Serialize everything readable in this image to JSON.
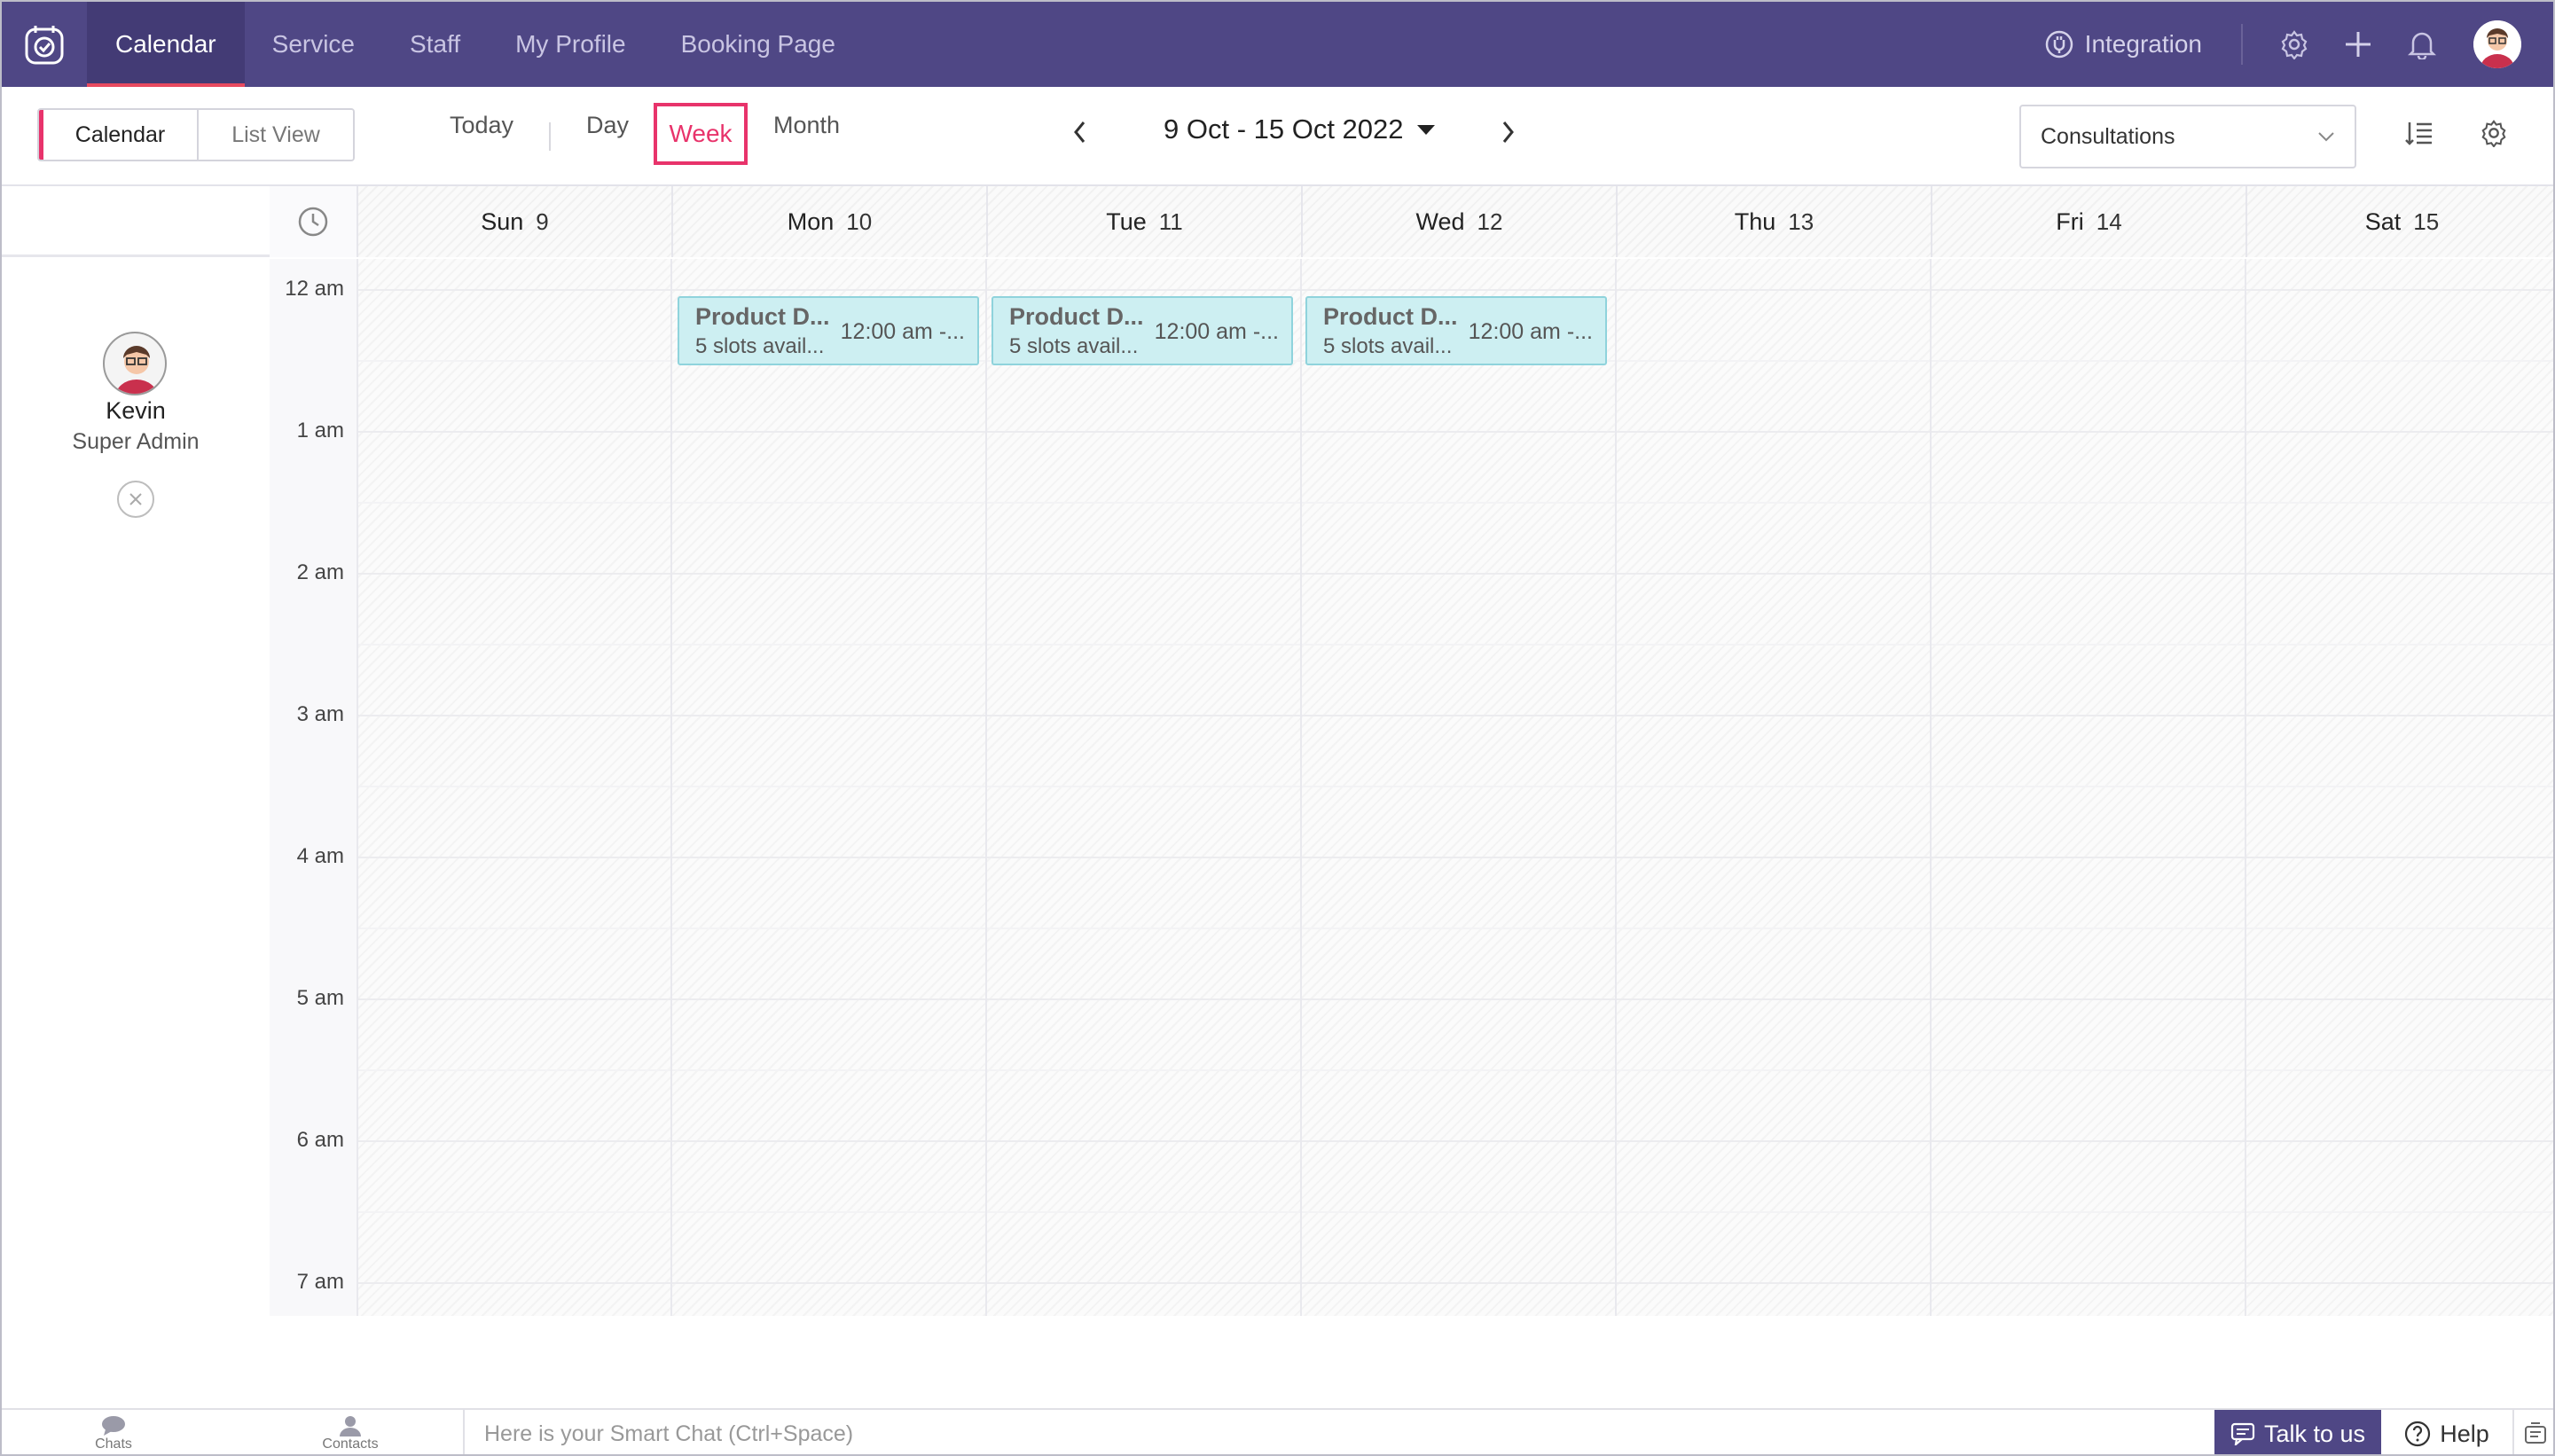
{
  "nav": {
    "tabs": [
      {
        "label": "Calendar"
      },
      {
        "label": "Service"
      },
      {
        "label": "Staff"
      },
      {
        "label": "My Profile"
      },
      {
        "label": "Booking Page"
      }
    ],
    "integration_label": "Integration"
  },
  "toolbar": {
    "view_calendar": "Calendar",
    "view_list": "List View",
    "today": "Today",
    "day": "Day",
    "week": "Week",
    "month": "Month",
    "date_range": "9 Oct - 15 Oct 2022",
    "select_value": "Consultations"
  },
  "days": [
    {
      "name": "Sun",
      "num": "9"
    },
    {
      "name": "Mon",
      "num": "10"
    },
    {
      "name": "Tue",
      "num": "11"
    },
    {
      "name": "Wed",
      "num": "12"
    },
    {
      "name": "Thu",
      "num": "13"
    },
    {
      "name": "Fri",
      "num": "14"
    },
    {
      "name": "Sat",
      "num": "15"
    }
  ],
  "times": [
    "12 am",
    "1 am",
    "2 am",
    "3 am",
    "4 am",
    "5 am",
    "6 am",
    "7 am"
  ],
  "staff": {
    "name": "Kevin",
    "role": "Super Admin"
  },
  "events": [
    {
      "title": "Product D...",
      "slots": "5 slots avail...",
      "time": "12:00 am -..."
    },
    {
      "title": "Product D...",
      "slots": "5 slots avail...",
      "time": "12:00 am -..."
    },
    {
      "title": "Product D...",
      "slots": "5 slots avail...",
      "time": "12:00 am -..."
    }
  ],
  "footer": {
    "chats": "Chats",
    "contacts": "Contacts",
    "chat_placeholder": "Here is your Smart Chat (Ctrl+Space)",
    "talk": "Talk to us",
    "help": "Help"
  },
  "colors": {
    "nav_bg": "#4f4785",
    "accent": "#e8336b",
    "event_bg": "#cdeff2"
  }
}
